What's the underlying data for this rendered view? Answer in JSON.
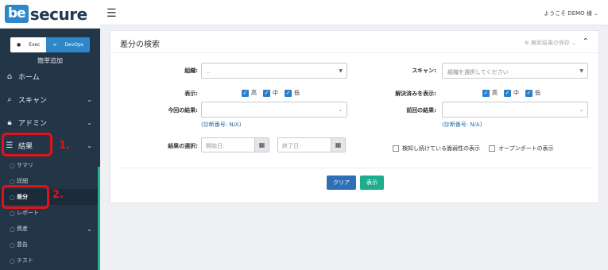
{
  "brand": {
    "be": "be",
    "secure": "secure"
  },
  "toggle": {
    "exec": "Exec",
    "devops": "DevOps"
  },
  "sidebar": {
    "simple_add": "簡単追加",
    "items": [
      {
        "label": "ホーム",
        "icon": "home-icon"
      },
      {
        "label": "スキャン",
        "icon": "search-icon"
      },
      {
        "label": "アドミン",
        "icon": "lock-icon"
      },
      {
        "label": "結果",
        "icon": "list-icon"
      }
    ],
    "subitems": [
      {
        "label": "サマリ"
      },
      {
        "label": "詳細"
      },
      {
        "label": "差分"
      },
      {
        "label": "レポート"
      },
      {
        "label": "資産"
      },
      {
        "label": "豊告"
      },
      {
        "label": "テスト"
      }
    ]
  },
  "annotations": {
    "step1": "1.",
    "step2": "2."
  },
  "topbar": {
    "welcome": "ようこそ DEMO 様"
  },
  "panel": {
    "title": "差分の検索",
    "saved_search": "⊕ 検索結果の保存 ⌄",
    "org_label": "組織:",
    "org_value": "..",
    "scan_label": "スキャン:",
    "scan_placeholder": "組織を選択してください",
    "display_label": "表示:",
    "resolved_label": "解決済みを表示:",
    "sev_high": "高",
    "sev_mid": "中",
    "sev_low": "低",
    "current_label": "今回の結果:",
    "previous_label": "前回の結果:",
    "scan_no": "(診断番号: N/A)",
    "result_select_label": "結果の選択:",
    "start_date": "開始日:",
    "end_date": "終了日:",
    "persist_vuln": "検知し続けている脆弱性の表示",
    "open_port": "オープンポートの表示",
    "clear_btn": "クリア",
    "show_btn": "表示"
  }
}
